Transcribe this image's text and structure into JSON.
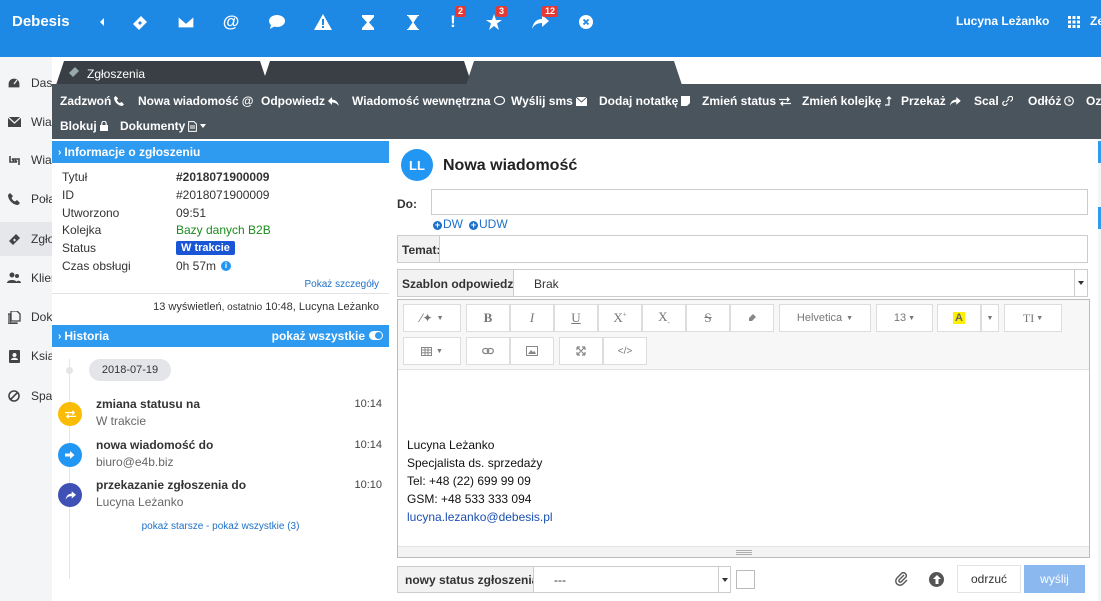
{
  "topbar": {
    "brand": "Debesis",
    "badges": {
      "alerts": "2",
      "favorites": "3",
      "forwards": "12"
    },
    "user_name": "Lucyna Leżanko",
    "apps_label": "Ze"
  },
  "leftnav": {
    "items": [
      {
        "label": "Daszboard",
        "icon": "dashboard-icon"
      },
      {
        "label": "Wiadomości",
        "icon": "envelope-icon"
      },
      {
        "label": "Wiadomości",
        "icon": "retweet-icon"
      },
      {
        "label": "Połączenia",
        "icon": "phone-icon"
      },
      {
        "label": "Zgłoszenia",
        "icon": "ticket-icon"
      },
      {
        "label": "Klienci",
        "icon": "users-icon"
      },
      {
        "label": "Dokumenty",
        "icon": "documents-icon"
      },
      {
        "label": "Książka",
        "icon": "address-book-icon"
      },
      {
        "label": "Spam",
        "icon": "ban-icon"
      }
    ]
  },
  "tabs": {
    "active_label": "Zgłoszenia"
  },
  "toolbar": {
    "row1": [
      "Zadzwoń",
      "Nowa wiadomość",
      "Odpowiedz",
      "Wiadomość wewnętrzna",
      "Wyślij sms",
      "Dodaj notatkę",
      "Zmień status",
      "Zmień kolejkę",
      "Przekaż",
      "Scal",
      "Odłóż",
      "Oz"
    ],
    "row2": [
      "Blokuj",
      "Dokumenty"
    ]
  },
  "info": {
    "heading": "Informacje o zgłoszeniu",
    "rows": [
      {
        "label": "Tytuł",
        "value": "#2018071900009"
      },
      {
        "label": "ID",
        "value": "#2018071900009"
      },
      {
        "label": "Utworzono",
        "value": "09:51"
      },
      {
        "label": "Kolejka",
        "value": "Bazy danych B2B"
      },
      {
        "label": "Status",
        "value": "W trakcie"
      },
      {
        "label": "Czas obsługi",
        "value": "0h 57m"
      }
    ],
    "details_link": "Pokaż szczegóły",
    "views_count": "13 wyświetleń",
    "views_last_prefix": ", ostatnio",
    "views_last_time": "10:48",
    "views_last_user": ", Lucyna Leżanko"
  },
  "history": {
    "heading": "Historia",
    "show_all": "pokaż wszystkie",
    "date": "2018-07-19",
    "items": [
      {
        "title": "zmiana statusu na",
        "sub": "W trakcie",
        "time": "10:14",
        "color": "#fbbc05"
      },
      {
        "title": "nowa wiadomość do",
        "sub": "biuro@e4b.biz",
        "time": "10:14",
        "color": "#2196f3"
      },
      {
        "title": "przekazanie zgłoszenia do",
        "sub": "Lucyna Leżanko",
        "time": "10:10",
        "color": "#3f51b5"
      }
    ],
    "footer_older": "pokaż starsze",
    "footer_sep": " - ",
    "footer_all": "pokaż wszystkie (3)"
  },
  "compose": {
    "avatar": "LL",
    "title": "Nowa wiadomość",
    "to_label": "Do:",
    "to_value": "",
    "cc_dw": "DW",
    "cc_udw": "UDW",
    "subject_label": "Temat:",
    "subject_value": "",
    "template_label": "Szablon odpowiedzi:",
    "template_value": "Brak",
    "editor": {
      "font": "Helvetica",
      "size": "13"
    },
    "signature": {
      "name": "Lucyna Leżanko",
      "role": "Specjalista ds. sprzedaży",
      "tel": "Tel: +48 (22) 699 99 09",
      "gsm": "GSM: +48 533 333 094",
      "email": "lucyna.lezanko@debesis.pl"
    },
    "status_label": "nowy status zgłoszenia:",
    "status_value": "---",
    "cancel": "odrzuć",
    "send": "wyślij"
  },
  "colors": {
    "brand": "#1e88e5",
    "toolbar": "#4a545d",
    "panel_head": "#2f9bf0"
  }
}
